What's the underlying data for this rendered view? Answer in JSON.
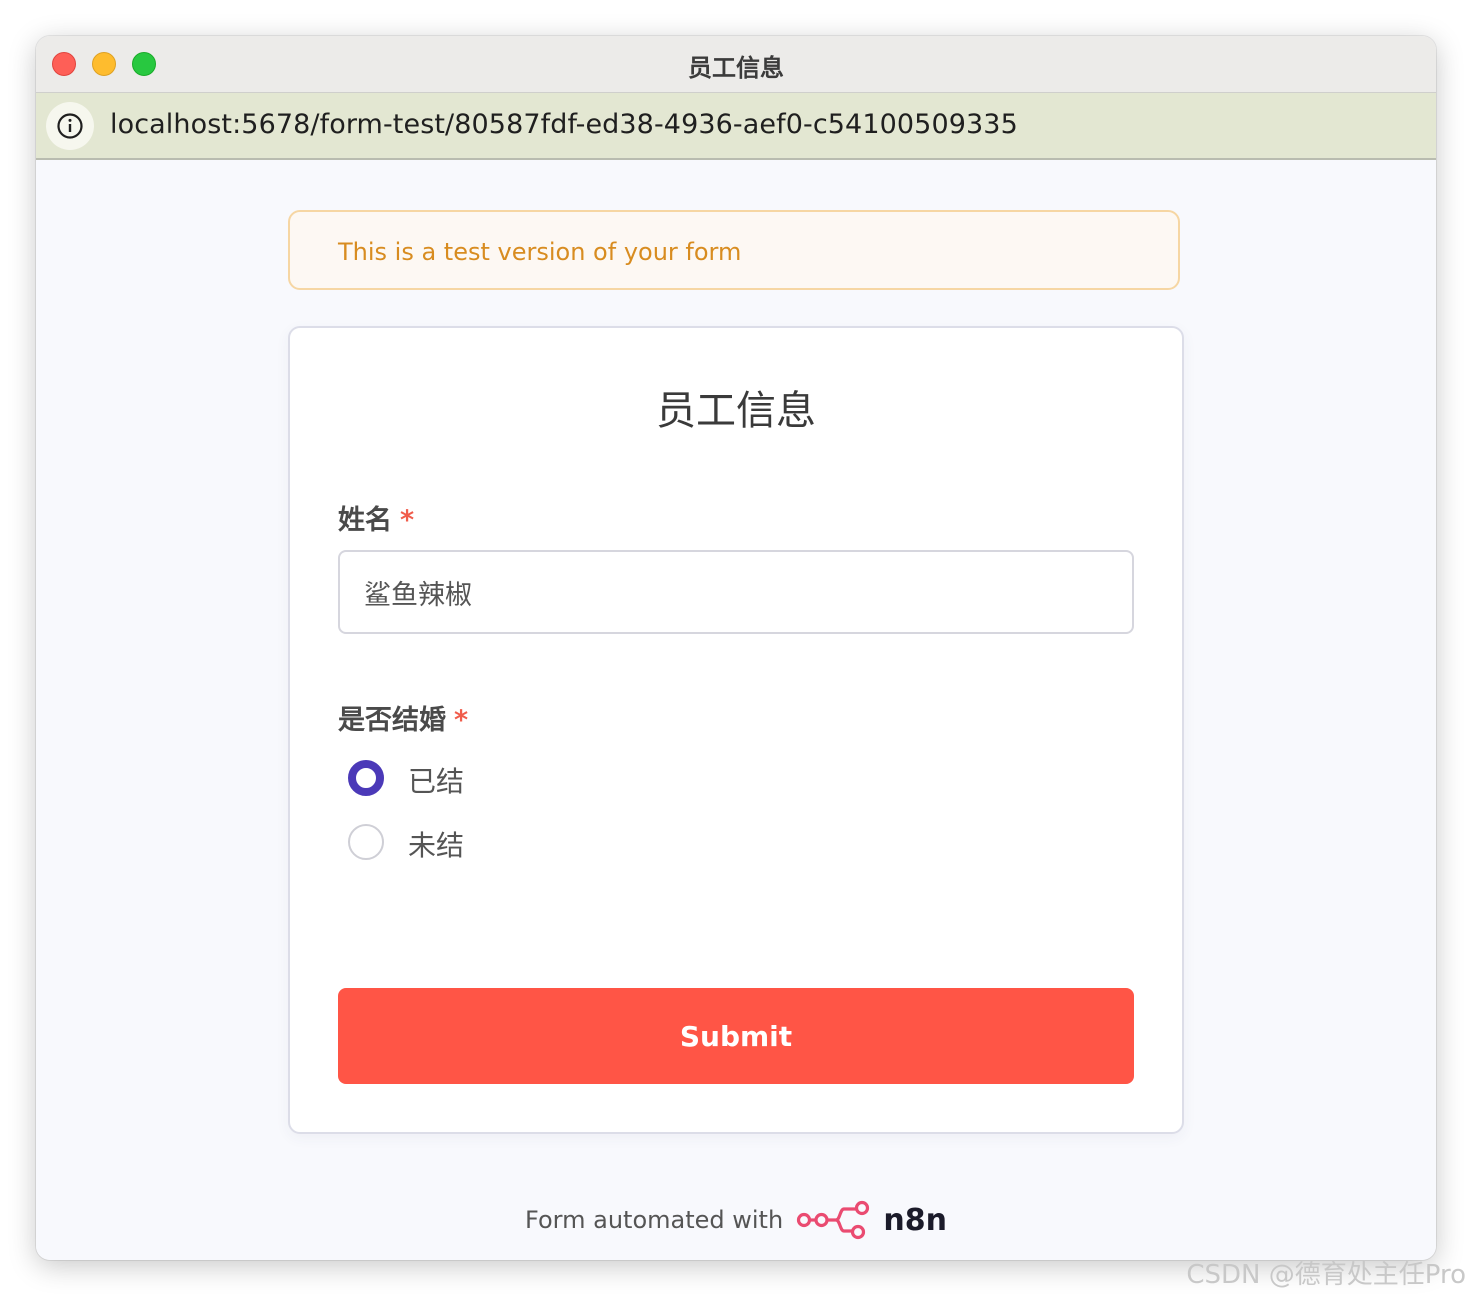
{
  "window": {
    "title": "员工信息"
  },
  "browser": {
    "url": "localhost:5678/form-test/80587fdf-ed38-4936-aef0-c54100509335",
    "info_icon": "info-circle-icon"
  },
  "banner": {
    "text": "This is a test version of your form"
  },
  "form": {
    "title": "员工信息",
    "fields": [
      {
        "label": "姓名",
        "required_mark": "*",
        "value": "鲨鱼辣椒"
      },
      {
        "label": "是否结婚",
        "required_mark": "*",
        "options": [
          {
            "label": "已结",
            "selected": true
          },
          {
            "label": "未结",
            "selected": false
          }
        ]
      }
    ],
    "submit_label": "Submit"
  },
  "footer": {
    "text": "Form automated with",
    "brand": "n8n",
    "logo_icon": "n8n-logo-icon"
  },
  "watermark": "CSDN @德育处主任Pro",
  "colors": {
    "accent_radio": "#4b39b8",
    "submit_bg": "#ff5546",
    "required": "#f05c4b",
    "banner_text": "#d88c20",
    "n8n_brand": "#ea4b71"
  }
}
